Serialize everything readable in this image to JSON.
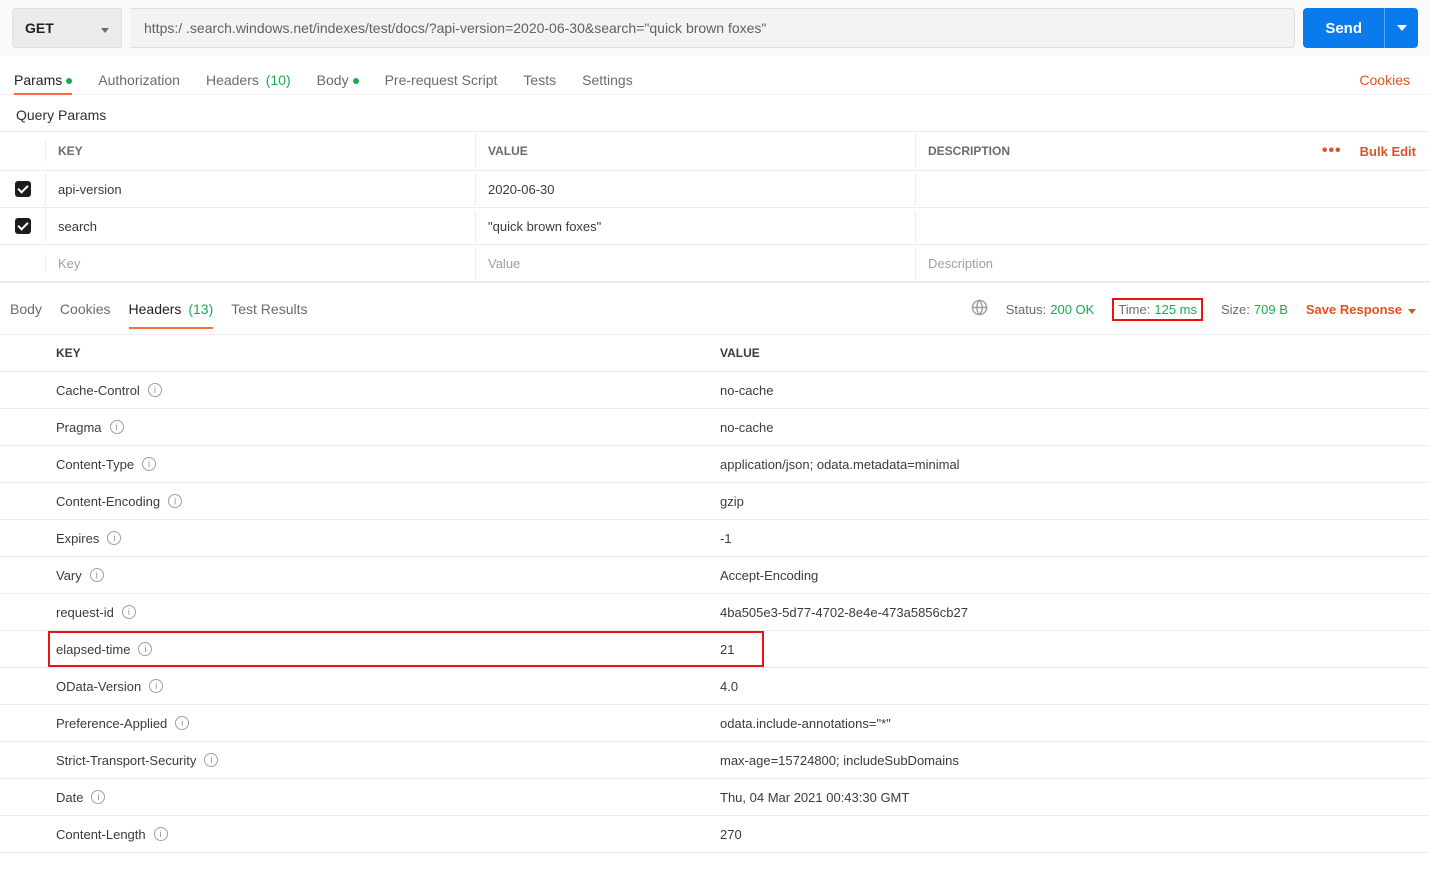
{
  "request": {
    "method": "GET",
    "url": "https:/           .search.windows.net/indexes/test/docs/?api-version=2020-06-30&search=\"quick brown foxes\"",
    "send_label": "Send"
  },
  "req_tabs": {
    "params": "Params",
    "authorization": "Authorization",
    "headers": "Headers",
    "headers_count": "(10)",
    "body": "Body",
    "prerequest": "Pre-request Script",
    "tests": "Tests",
    "settings": "Settings",
    "cookies": "Cookies"
  },
  "params_section_label": "Query Params",
  "params_columns": {
    "key": "KEY",
    "value": "VALUE",
    "description": "DESCRIPTION",
    "bulk_edit": "Bulk Edit"
  },
  "params": [
    {
      "checked": true,
      "key": "api-version",
      "value": "2020-06-30",
      "description": ""
    },
    {
      "checked": true,
      "key": "search",
      "value": "\"quick brown foxes\"",
      "description": ""
    }
  ],
  "params_placeholder": {
    "key": "Key",
    "value": "Value",
    "description": "Description"
  },
  "resp_tabs": {
    "body": "Body",
    "cookies": "Cookies",
    "headers": "Headers",
    "headers_count": "(13)",
    "test_results": "Test Results"
  },
  "resp_meta": {
    "status_label": "Status:",
    "status_value": "200 OK",
    "time_label": "Time:",
    "time_value": "125 ms",
    "size_label": "Size:",
    "size_value": "709 B",
    "save_response": "Save Response"
  },
  "headers_columns": {
    "key": "KEY",
    "value": "VALUE"
  },
  "response_headers": [
    {
      "key": "Cache-Control",
      "value": "no-cache"
    },
    {
      "key": "Pragma",
      "value": "no-cache"
    },
    {
      "key": "Content-Type",
      "value": "application/json; odata.metadata=minimal"
    },
    {
      "key": "Content-Encoding",
      "value": "gzip"
    },
    {
      "key": "Expires",
      "value": "-1"
    },
    {
      "key": "Vary",
      "value": "Accept-Encoding"
    },
    {
      "key": "request-id",
      "value": "4ba505e3-5d77-4702-8e4e-473a5856cb27"
    },
    {
      "key": "elapsed-time",
      "value": "21",
      "highlight": true
    },
    {
      "key": "OData-Version",
      "value": "4.0"
    },
    {
      "key": "Preference-Applied",
      "value": "odata.include-annotations=\"*\""
    },
    {
      "key": "Strict-Transport-Security",
      "value": "max-age=15724800; includeSubDomains"
    },
    {
      "key": "Date",
      "value": "Thu, 04 Mar 2021 00:43:30 GMT"
    },
    {
      "key": "Content-Length",
      "value": "270"
    }
  ]
}
